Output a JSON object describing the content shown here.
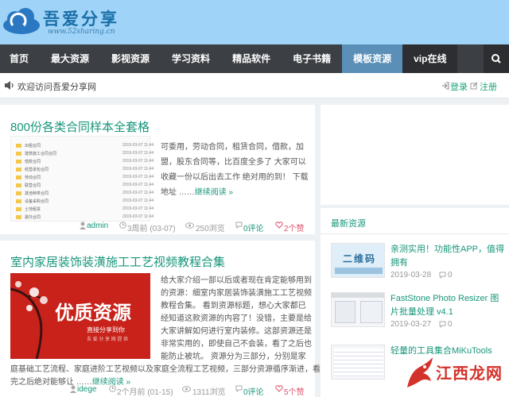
{
  "site": {
    "logo_title": "吾爱分享",
    "logo_url": "www.52sharing.cn",
    "watermark": "江西龙网"
  },
  "nav": {
    "items": [
      "首页",
      "最大资源",
      "影视资源",
      "学习资料",
      "精品软件",
      "电子书籍",
      "模板资源",
      "vip在线"
    ],
    "active": "模板资源",
    "search_icon": "search-icon"
  },
  "notice": {
    "text": "欢迎访问吾爱分享网",
    "login": "登录",
    "register": "注册"
  },
  "posts": [
    {
      "title": "800份各类合同样本全套格",
      "excerpt": "可委用，劳动合同，租赁合同，借款，加盟，股东合同等，比百度全多了 大家可以收藏一份以后出去工作 绝对用的到！ 下载地址 ……",
      "more": "继续阅读 »",
      "author": "admin",
      "time": "3周前 (03-07)",
      "views": "250浏览",
      "comments": "0评论",
      "likes": "2个赞",
      "files": [
        {
          "name": "出租合同",
          "date": "2019-03-07 11:44"
        },
        {
          "name": "建筑施工合同合同",
          "date": "2019-03-07 11:44"
        },
        {
          "name": "借款合同",
          "date": "2019-03-07 11:44"
        },
        {
          "name": "经营承包合同",
          "date": "2019-03-07 11:44"
        },
        {
          "name": "劳动合同",
          "date": "2019-03-07 11:44"
        },
        {
          "name": "联营合同",
          "date": "2019-03-07 11:44"
        },
        {
          "name": "其他种类合同",
          "date": "2019-03-07 11:44"
        },
        {
          "name": "设备采购合同",
          "date": "2019-03-07 11:44"
        },
        {
          "name": "土地租赁",
          "date": "2019-03-07 11:44"
        },
        {
          "name": "委托合同",
          "date": "2019-03-07 11:44"
        }
      ]
    },
    {
      "title": "室内家居装饰装潢施工工艺视频教程合集",
      "excerpt_lines": [
        "给大家介绍一部以后或者现在肯定能够用到",
        "的资源：细室内家居装饰装潢施工工艺视频",
        "教程合集。 看到资源标题，想心大家都已",
        "经知道这款资源的内容了！没错，主要是给",
        "大家讲解如何进行室内装修。这部资源还是",
        "非常实用的，即使自己不会装，看了之后也",
        "能防止被坑。 资源分为三部分，分别是家",
        "庭基础工艺流程、家庭进阶工艺视频以及家庭全流程工艺视频，三部分资源循序渐进，看",
        "完之后绝对能够让 ……"
      ],
      "more": "继续阅读 »",
      "author": "idege",
      "time": "2个月前 (01-15)",
      "views": "1311浏览",
      "comments": "0评论",
      "likes": "5个赞",
      "thumb_big": "优质资源",
      "thumb_sub": "直接分享到你",
      "thumb_sub2": "吾 爱 分 享 网 提 供"
    }
  ],
  "sidebar": {
    "heading": "最新资源",
    "items": [
      {
        "title": "亲测实用！功能性APP，值得拥有",
        "date": "2019-03-28",
        "comments": "0",
        "thumb_text": "二维码"
      },
      {
        "title": "FastStone Photo Resizer 图片批量处理 v4.1",
        "date": "2019-03-27",
        "comments": "0"
      },
      {
        "title": "轻量的工具集合MiKuTools",
        "date": ""
      }
    ]
  },
  "colors": {
    "header_bg": "#9fd3f7",
    "nav_bg": "#3c3f43",
    "nav_active": "#5a8fb8",
    "accent_green": "#17967a",
    "like_red": "#e0526e"
  }
}
